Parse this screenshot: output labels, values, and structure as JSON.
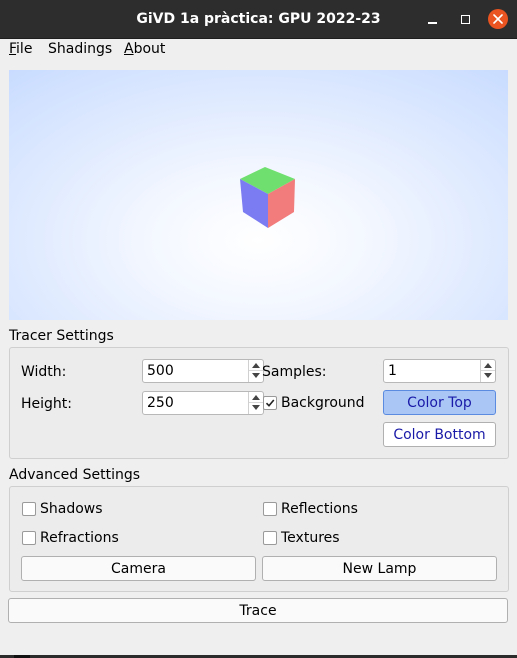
{
  "window": {
    "title": "GiVD 1a pràctica: GPU 2022-23"
  },
  "menu": {
    "file_acc": "F",
    "file_rest": "ile",
    "shadings": "Shadings",
    "about_acc": "A",
    "about_rest": "bout"
  },
  "tracer": {
    "label": "Tracer Settings",
    "width_label": "Width:",
    "width_value": "500",
    "height_label": "Height:",
    "height_value": "250",
    "samples_label": "Samples:",
    "samples_value": "1",
    "background_label": "Background",
    "background_checked": true,
    "color_top": "Color Top",
    "color_bottom": "Color Bottom"
  },
  "advanced": {
    "label": "Advanced Settings",
    "shadows": "Shadows",
    "reflections": "Reflections",
    "refractions": "Refractions",
    "textures": "Textures",
    "camera": "Camera",
    "new_lamp": "New Lamp"
  },
  "trace_button": "Trace",
  "colors": {
    "accent": "#e95420",
    "cube_top": "#6fe06f",
    "cube_left": "#7b7bf2",
    "cube_right": "#f27b7b",
    "highlight_button": "#a9c6f5"
  }
}
